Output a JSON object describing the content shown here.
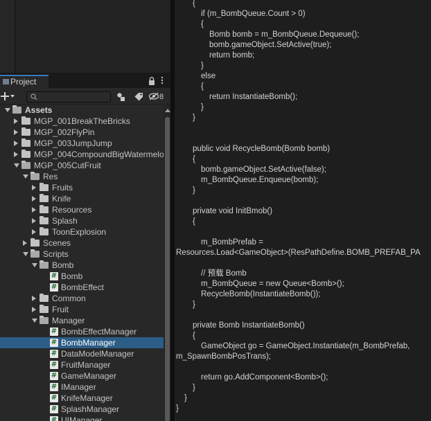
{
  "project_panel": {
    "tab_title": "Project",
    "search": {
      "value": "",
      "placeholder": ""
    },
    "hidden_count": "8"
  },
  "tree": [
    {
      "label": "Assets",
      "depth": 0,
      "kind": "folder",
      "state": "open",
      "bold": true
    },
    {
      "label": "MGP_001BreakTheBricks",
      "depth": 1,
      "kind": "folder",
      "state": "closed"
    },
    {
      "label": "MGP_002FlyPin",
      "depth": 1,
      "kind": "folder",
      "state": "closed"
    },
    {
      "label": "MGP_003JumpJump",
      "depth": 1,
      "kind": "folder",
      "state": "closed"
    },
    {
      "label": "MGP_004CompoundBigWatermelo",
      "depth": 1,
      "kind": "folder",
      "state": "closed"
    },
    {
      "label": "MGP_005CutFruit",
      "depth": 1,
      "kind": "folder",
      "state": "open"
    },
    {
      "label": "Res",
      "depth": 2,
      "kind": "folder",
      "state": "open"
    },
    {
      "label": "Fruits",
      "depth": 3,
      "kind": "folder",
      "state": "closed"
    },
    {
      "label": "Knife",
      "depth": 3,
      "kind": "folder",
      "state": "closed"
    },
    {
      "label": "Resources",
      "depth": 3,
      "kind": "folder",
      "state": "closed"
    },
    {
      "label": "Splash",
      "depth": 3,
      "kind": "folder",
      "state": "closed"
    },
    {
      "label": "ToonExplosion",
      "depth": 3,
      "kind": "folder",
      "state": "closed"
    },
    {
      "label": "Scenes",
      "depth": 2,
      "kind": "folder",
      "state": "closed"
    },
    {
      "label": "Scripts",
      "depth": 2,
      "kind": "folder",
      "state": "open"
    },
    {
      "label": "Bomb",
      "depth": 3,
      "kind": "folder",
      "state": "open"
    },
    {
      "label": "Bomb",
      "depth": 4,
      "kind": "script"
    },
    {
      "label": "BombEffect",
      "depth": 4,
      "kind": "script"
    },
    {
      "label": "Common",
      "depth": 3,
      "kind": "folder",
      "state": "closed"
    },
    {
      "label": "Fruit",
      "depth": 3,
      "kind": "folder",
      "state": "closed"
    },
    {
      "label": "Manager",
      "depth": 3,
      "kind": "folder",
      "state": "open"
    },
    {
      "label": "BombEffectManager",
      "depth": 4,
      "kind": "script"
    },
    {
      "label": "BombManager",
      "depth": 4,
      "kind": "script",
      "selected": true
    },
    {
      "label": "DataModelManager",
      "depth": 4,
      "kind": "script"
    },
    {
      "label": "FruitManager",
      "depth": 4,
      "kind": "script"
    },
    {
      "label": "GameManager",
      "depth": 4,
      "kind": "script"
    },
    {
      "label": "IManager",
      "depth": 4,
      "kind": "script"
    },
    {
      "label": "KnifeManager",
      "depth": 4,
      "kind": "script"
    },
    {
      "label": "SplashManager",
      "depth": 4,
      "kind": "script"
    },
    {
      "label": "UIManager",
      "depth": 4,
      "kind": "script"
    }
  ],
  "code_lines": [
    {
      "text": "{",
      "indent": 2,
      "row": -0.6
    },
    {
      "text": "if (m_BombQueue.Count > 0)",
      "indent": 3,
      "row": 0.4
    },
    {
      "text": "{",
      "indent": 3,
      "row": 1.4
    },
    {
      "text": "Bomb bomb = m_BombQueue.Dequeue();",
      "indent": 4,
      "row": 2.4
    },
    {
      "text": "bomb.gameObject.SetActive(true);",
      "indent": 4,
      "row": 3.4
    },
    {
      "text": "return bomb;",
      "indent": 4,
      "row": 4.4
    },
    {
      "text": "}",
      "indent": 3,
      "row": 5.4
    },
    {
      "text": "else",
      "indent": 3,
      "row": 6.4
    },
    {
      "text": "{",
      "indent": 3,
      "row": 7.4
    },
    {
      "text": "return InstantiateBomb();",
      "indent": 4,
      "row": 8.4
    },
    {
      "text": "}",
      "indent": 3,
      "row": 9.4
    },
    {
      "text": "}",
      "indent": 2,
      "row": 10.4
    },
    {
      "text": "public void RecycleBomb(Bomb bomb)",
      "indent": 2,
      "row": 13.4
    },
    {
      "text": "{",
      "indent": 2,
      "row": 14.4
    },
    {
      "text": "bomb.gameObject.SetActive(false);",
      "indent": 3,
      "row": 15.4
    },
    {
      "text": "m_BombQueue.Enqueue(bomb);",
      "indent": 3,
      "row": 16.4
    },
    {
      "text": "}",
      "indent": 2,
      "row": 17.4
    },
    {
      "text": "private void InitBmob()",
      "indent": 2,
      "row": 19.4
    },
    {
      "text": "{",
      "indent": 2,
      "row": 20.4
    },
    {
      "text": "m_BombPrefab =",
      "indent": 3,
      "row": 22.4
    },
    {
      "text": "Resources.Load<GameObject>(ResPathDefine.BOMB_PREFAB_PA",
      "indent": 0,
      "row": 23.4
    },
    {
      "text": "// 预载 Bomb",
      "indent": 3,
      "row": 25.4
    },
    {
      "text": "m_BombQueue = new Queue<Bomb>();",
      "indent": 3,
      "row": 26.4
    },
    {
      "text": "RecycleBomb(InstantiateBomb());",
      "indent": 3,
      "row": 27.4
    },
    {
      "text": "}",
      "indent": 2,
      "row": 28.4
    },
    {
      "text": "private Bomb InstantiateBomb()",
      "indent": 2,
      "row": 30.4
    },
    {
      "text": "{",
      "indent": 2,
      "row": 31.4
    },
    {
      "text": "GameObject go = GameObject.Instantiate(m_BombPrefab,",
      "indent": 3,
      "row": 32.4
    },
    {
      "text": "m_SpawnBombPosTrans);",
      "indent": 0,
      "row": 33.4
    },
    {
      "text": "return go.AddComponent<Bomb>();",
      "indent": 3,
      "row": 35.4
    },
    {
      "text": "}",
      "indent": 2,
      "row": 36.4
    },
    {
      "text": "}",
      "indent": 1,
      "row": 37.4
    },
    {
      "text": "}",
      "indent": 0,
      "row": 38.4
    }
  ],
  "colors": {
    "accent": "#3a79bb",
    "selection": "#2c5d87",
    "panel_bg": "#282828",
    "editor_bg": "#1e1e1e"
  }
}
